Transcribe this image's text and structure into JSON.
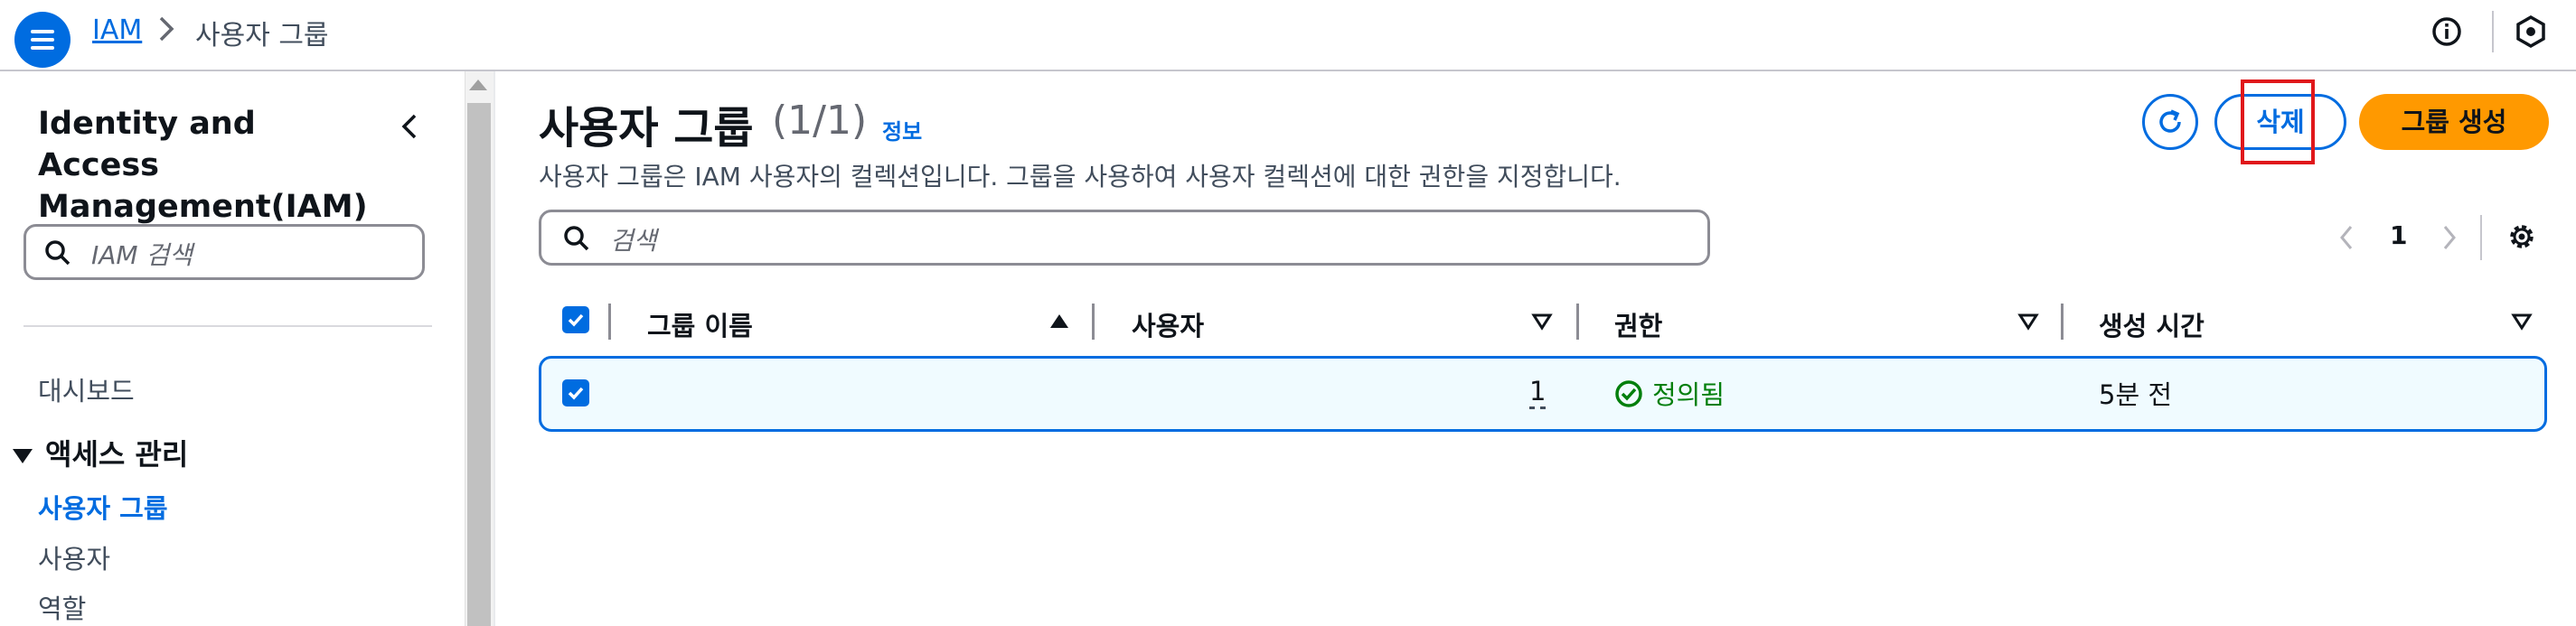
{
  "breadcrumb": {
    "root": "IAM",
    "current": "사용자 그룹"
  },
  "sidebar": {
    "title": "Identity and Access Management(IAM)",
    "search_placeholder": "IAM 검색",
    "items": [
      {
        "label": "대시보드"
      },
      {
        "label": "액세스 관리"
      },
      {
        "label": "사용자 그룹"
      },
      {
        "label": "사용자"
      },
      {
        "label": "역할"
      }
    ]
  },
  "main": {
    "title": "사용자 그룹",
    "count": "(1/1)",
    "info_link": "정보",
    "description": "사용자 그룹은 IAM 사용자의 컬렉션입니다. 그룹을 사용하여 사용자 컬렉션에 대한 권한을 지정합니다.",
    "delete_label": "삭제",
    "create_label": "그룹 생성",
    "search_placeholder": "검색",
    "page_number": "1"
  },
  "table": {
    "columns": [
      "그룹 이름",
      "사용자",
      "권한",
      "생성 시간"
    ],
    "rows": [
      {
        "group_name": "",
        "users": "1",
        "permissions": "정의됨",
        "created": "5분 전"
      }
    ]
  },
  "colors": {
    "accent": "#006ce0",
    "primary_button": "#ff9900",
    "success": "#037f0c",
    "highlight": "#e0181b"
  },
  "icons": [
    "menu-icon",
    "chevron-right-icon",
    "info-icon",
    "hexagon-icon",
    "chevron-left-icon",
    "search-icon",
    "refresh-icon",
    "gear-icon",
    "check-icon",
    "success-icon",
    "sort-icon"
  ]
}
